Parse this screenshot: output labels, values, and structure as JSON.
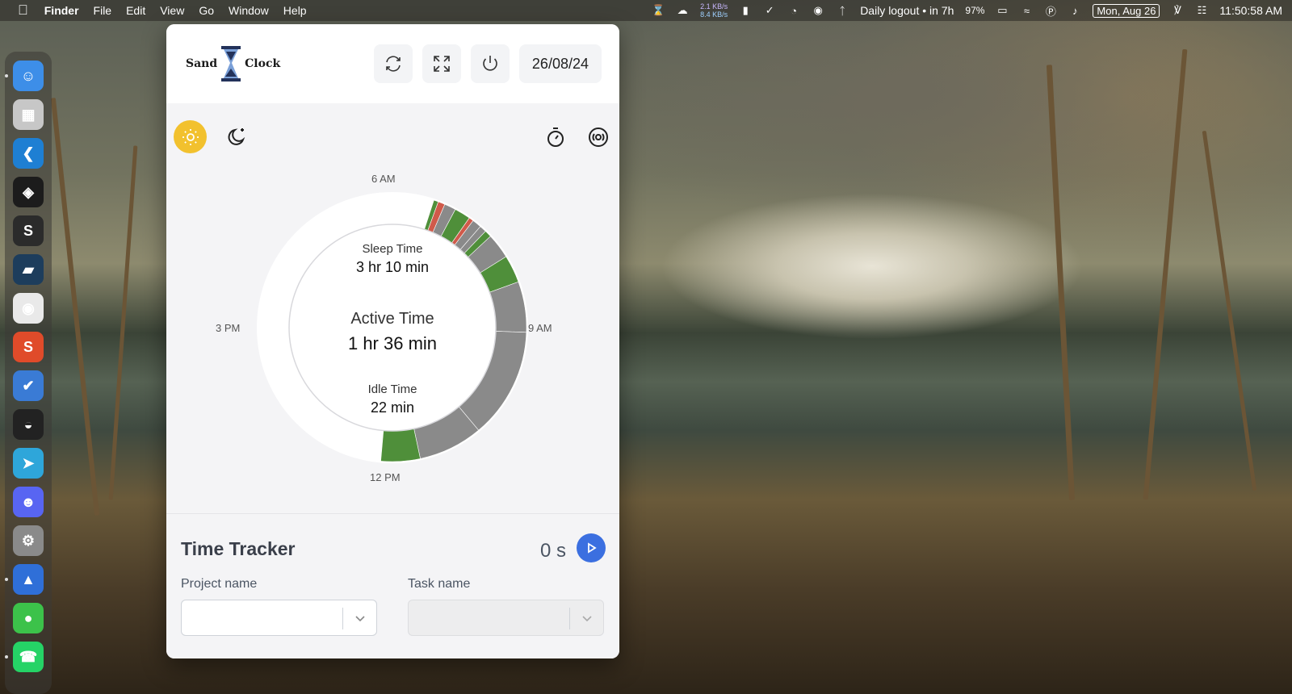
{
  "menubar": {
    "app_name": "Finder",
    "menus": [
      "File",
      "Edit",
      "View",
      "Go",
      "Window",
      "Help"
    ],
    "net_up": "2.1 KB/s",
    "net_down": "8.4 KB/s",
    "logout_status": "Daily logout • in 7h",
    "battery": "97%",
    "date": "Mon, Aug 26",
    "time": "11:50:58 AM"
  },
  "dock": {
    "apps": [
      {
        "name": "finder",
        "color": "#3d8ee8",
        "glyph": "☺"
      },
      {
        "name": "launchpad",
        "color": "#c7c7c7",
        "glyph": "▦"
      },
      {
        "name": "vscode",
        "color": "#1e7fd3",
        "glyph": "❮"
      },
      {
        "name": "cube-app",
        "color": "#1c1c1c",
        "glyph": "◈"
      },
      {
        "name": "sublime",
        "color": "#2b2b2b",
        "glyph": "S"
      },
      {
        "name": "window-app",
        "color": "#1d3d5c",
        "glyph": "▰"
      },
      {
        "name": "chrome",
        "color": "#e9e9e9",
        "glyph": "◉"
      },
      {
        "name": "s-app",
        "color": "#e04b2a",
        "glyph": "S"
      },
      {
        "name": "tasks",
        "color": "#3a7bd5",
        "glyph": "✔"
      },
      {
        "name": "linear",
        "color": "#222",
        "glyph": "◒"
      },
      {
        "name": "telegram",
        "color": "#2ea6da",
        "glyph": "➤"
      },
      {
        "name": "discord",
        "color": "#5865f2",
        "glyph": "☻"
      },
      {
        "name": "settings",
        "color": "#8a8a8a",
        "glyph": "⚙"
      },
      {
        "name": "arrow-app",
        "color": "#2f6fd8",
        "glyph": "▲"
      },
      {
        "name": "messages",
        "color": "#3cc24a",
        "glyph": "●"
      },
      {
        "name": "whatsapp",
        "color": "#25d366",
        "glyph": "☎"
      }
    ]
  },
  "app": {
    "logo_left": "Sand",
    "logo_right": "Clock",
    "header_date": "26/08/24",
    "hour_labels": {
      "top": "6 AM",
      "right": "9 AM",
      "bottom": "12 PM",
      "left": "3 PM"
    },
    "stats": {
      "sleep_label": "Sleep Time",
      "sleep_value": "3 hr 10 min",
      "active_label": "Active Time",
      "active_value": "1 hr 36 min",
      "idle_label": "Idle Time",
      "idle_value": "22 min"
    },
    "tracker": {
      "title": "Time Tracker",
      "elapsed": "0 s",
      "project_label": "Project name",
      "task_label": "Task name"
    },
    "colors": {
      "sun": "#f2c12e",
      "active": "#4f8f3a",
      "idle": "#8a8a8a",
      "alert": "#d05a4a",
      "play": "#3b6fe0"
    }
  }
}
